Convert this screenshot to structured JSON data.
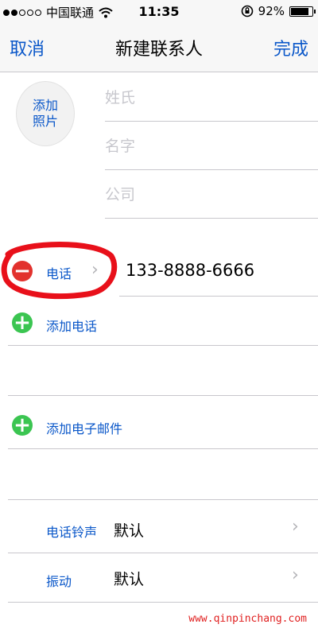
{
  "statusbar": {
    "carrier": "中国联通",
    "time": "11:35",
    "battery_percent": "92%",
    "battery_level": 0.92,
    "icons": [
      "wifi-icon",
      "orientation-lock-icon",
      "battery-icon"
    ]
  },
  "navbar": {
    "cancel": "取消",
    "title": "新建联系人",
    "done": "完成"
  },
  "photo": {
    "label_line1": "添加",
    "label_line2": "照片"
  },
  "fields": {
    "last_name_placeholder": "姓氏",
    "first_name_placeholder": "名字",
    "company_placeholder": "公司"
  },
  "phone": {
    "label": "电话",
    "number": "133-8888-6666"
  },
  "add_phone": "添加电话",
  "add_email": "添加电子邮件",
  "ringtone": {
    "label": "电话铃声",
    "value": "默认"
  },
  "vibration": {
    "label": "振动",
    "value": "默认"
  },
  "watermark": "www.qinpinchang.com",
  "colors": {
    "accent": "#0a57c9",
    "delete": "#e2312d",
    "add": "#3bc551",
    "highlight": "#e8101a"
  }
}
